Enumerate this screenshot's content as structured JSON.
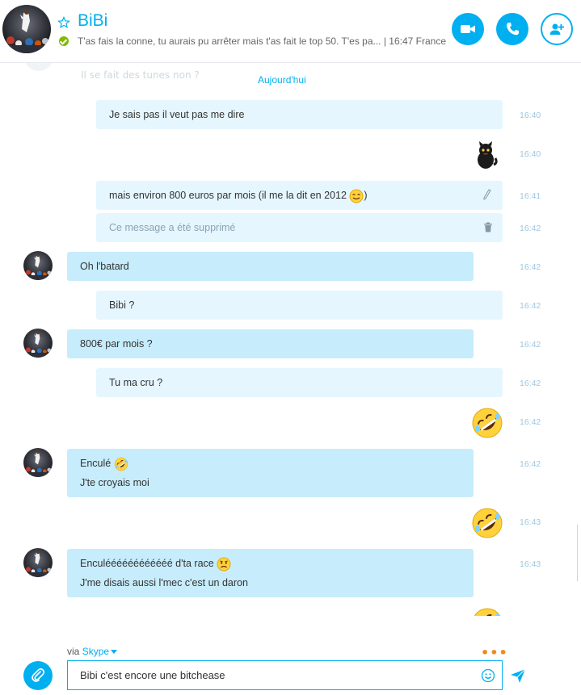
{
  "header": {
    "contact_name": "BiBi",
    "mood": "T'as fais la conne, tu aurais pu arrêter mais t'as fait le top 50. T'es pa...  |  16:47 France",
    "status": "online",
    "actions": [
      "video-call",
      "audio-call",
      "add-people"
    ]
  },
  "conversation": {
    "ghost_text": "Il se fait des tunes non ?",
    "day_label": "Aujourd'hui",
    "messages": [
      {
        "dir": "out",
        "lines": [
          "Je sais pas il veut pas me dire"
        ],
        "time": "16:40"
      },
      {
        "dir": "out",
        "sticker": "cat",
        "time": "16:40"
      },
      {
        "dir": "out",
        "lines": [
          "mais environ 800 euros par mois (il me la dit en 2012 ",
          ")"
        ],
        "emoticon": "wink-smile",
        "edited": true,
        "time": "16:41"
      },
      {
        "dir": "out",
        "lines": [
          "Ce message a été supprimé"
        ],
        "deleted": true,
        "time": "16:42"
      },
      {
        "dir": "in",
        "lines": [
          "Oh l'batard"
        ],
        "time": "16:42"
      },
      {
        "dir": "out",
        "lines": [
          "Bibi ?"
        ],
        "time": "16:42"
      },
      {
        "dir": "in",
        "lines": [
          "800€ par mois ?"
        ],
        "time": "16:42"
      },
      {
        "dir": "out",
        "lines": [
          "Tu ma cru ?"
        ],
        "time": "16:42"
      },
      {
        "dir": "out",
        "big_emoticon": "laugh",
        "time": "16:42"
      },
      {
        "dir": "in",
        "lines": [
          "Enculé ",
          "J'te croyais moi"
        ],
        "emoticon": "laugh",
        "time": "16:42"
      },
      {
        "dir": "out",
        "big_emoticon": "laugh",
        "time": "16:43"
      },
      {
        "dir": "in",
        "lines": [
          "Enculéééééééééééé d'ta race ",
          "J'me disais aussi l'mec c'est un daron"
        ],
        "emoticon": "sad",
        "time": "16:43"
      }
    ]
  },
  "composer": {
    "via_prefix": "via",
    "via_brand": "Skype",
    "input_value": "Bibi c'est encore une bitchease"
  },
  "colors": {
    "accent": "#00aff0",
    "outgoing_bubble": "#e5f6fe",
    "incoming_bubble": "#c7ecfc",
    "online": "#7fba00",
    "typing_dots": "#f08a24"
  }
}
